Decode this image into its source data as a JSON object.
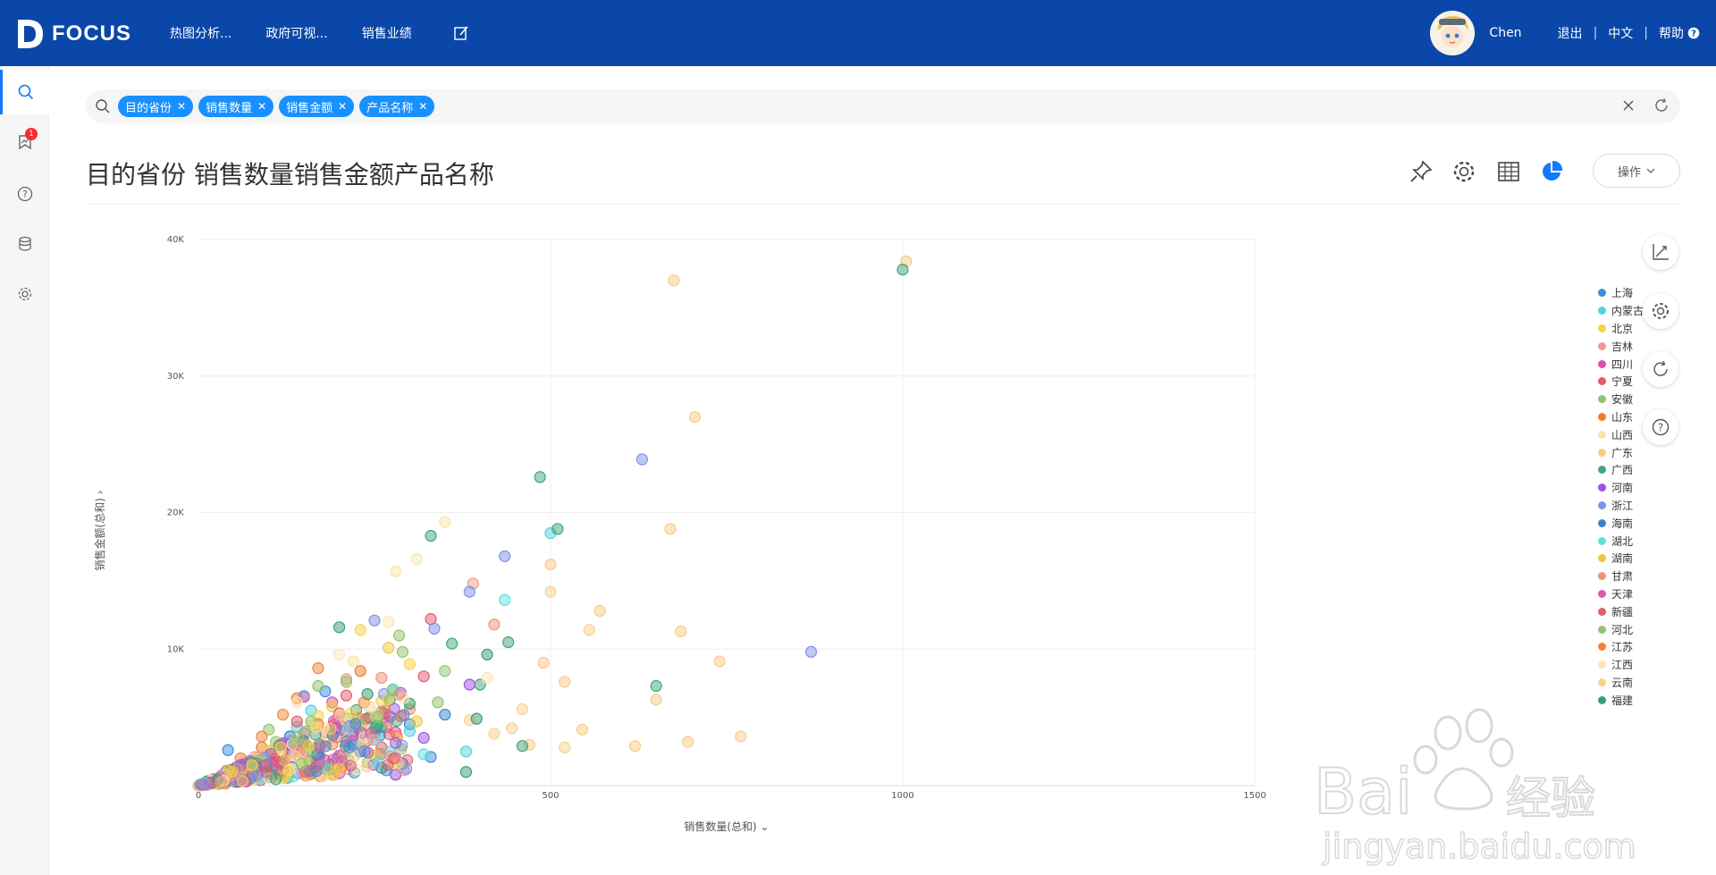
{
  "brand": {
    "name": "FOCUS"
  },
  "nav": {
    "items": [
      "热图分析...",
      "政府可视...",
      "销售业绩"
    ]
  },
  "user": {
    "name": "Chen",
    "logout": "退出",
    "language": "中文",
    "help": "帮助"
  },
  "sidebar": {
    "notification_count": "1"
  },
  "search": {
    "chips": [
      {
        "label": "目的省份"
      },
      {
        "label": "销售数量"
      },
      {
        "label": "销售金额"
      },
      {
        "label": "产品名称"
      }
    ]
  },
  "page": {
    "title": "目的省份 销售数量销售金额产品名称",
    "ops_label": "操作"
  },
  "colors": {
    "topbar": "#0a47a8",
    "accent": "#1890ff"
  },
  "chart_data": {
    "type": "scatter",
    "xlabel": "销售数量(总和)",
    "ylabel": "销售金额(总和)",
    "xlim": [
      0,
      1500
    ],
    "ylim": [
      0,
      40000
    ],
    "x_ticks": [
      "0",
      "500",
      "1000",
      "1500"
    ],
    "y_ticks": [
      "10K",
      "20K",
      "30K",
      "40K"
    ],
    "legend_position": "right",
    "grid": true,
    "series": [
      {
        "name": "上海",
        "color": "#3b8fd9",
        "points": [
          [
            42,
            2600
          ],
          [
            180,
            6900
          ],
          [
            210,
            3200
          ],
          [
            330,
            2100
          ],
          [
            70,
            900
          ],
          [
            300,
            4500
          ],
          [
            120,
            1800
          ],
          [
            260,
            5400
          ]
        ]
      },
      {
        "name": "内蒙古",
        "color": "#57d0e0",
        "points": [
          [
            500,
            18500
          ],
          [
            160,
            5500
          ],
          [
            300,
            4000
          ],
          [
            380,
            2500
          ],
          [
            220,
            3600
          ],
          [
            90,
            1200
          ],
          [
            140,
            4300
          ]
        ]
      },
      {
        "name": "北京",
        "color": "#f5d24a",
        "points": [
          [
            230,
            11400
          ],
          [
            300,
            8900
          ],
          [
            170,
            5100
          ],
          [
            60,
            1300
          ],
          [
            110,
            2700
          ],
          [
            260,
            6200
          ]
        ]
      },
      {
        "name": "吉林",
        "color": "#f29b8c",
        "points": [
          [
            390,
            14800
          ],
          [
            210,
            7800
          ],
          [
            150,
            3300
          ],
          [
            80,
            2100
          ],
          [
            240,
            4900
          ]
        ]
      },
      {
        "name": "四川",
        "color": "#d94fb0",
        "points": [
          [
            190,
            6100
          ],
          [
            120,
            3100
          ],
          [
            60,
            800
          ],
          [
            280,
            3900
          ],
          [
            170,
            2200
          ]
        ]
      },
      {
        "name": "宁夏",
        "color": "#e35b6b",
        "points": [
          [
            330,
            12200
          ],
          [
            210,
            6600
          ],
          [
            140,
            4700
          ],
          [
            90,
            1900
          ],
          [
            260,
            2800
          ]
        ]
      },
      {
        "name": "安徽",
        "color": "#8fc46a",
        "points": [
          [
            290,
            9800
          ],
          [
            170,
            7300
          ],
          [
            100,
            4100
          ],
          [
            60,
            1500
          ],
          [
            230,
            3700
          ],
          [
            340,
            6100
          ]
        ]
      },
      {
        "name": "山东",
        "color": "#f07d2e",
        "points": [
          [
            230,
            8400
          ],
          [
            140,
            6400
          ],
          [
            90,
            2800
          ],
          [
            170,
            4500
          ],
          [
            40,
            1100
          ]
        ]
      },
      {
        "name": "山西",
        "color": "#fbe3a8",
        "points": [
          [
            350,
            19300
          ],
          [
            280,
            15700
          ],
          [
            220,
            9100
          ],
          [
            160,
            4400
          ],
          [
            80,
            2000
          ]
        ]
      },
      {
        "name": "广东",
        "color": "#f7cc86",
        "points": [
          [
            1005,
            38400
          ],
          [
            675,
            37000
          ],
          [
            705,
            27000
          ],
          [
            670,
            18800
          ],
          [
            500,
            16200
          ],
          [
            570,
            12800
          ],
          [
            685,
            11300
          ],
          [
            740,
            9100
          ],
          [
            650,
            6300
          ],
          [
            770,
            3600
          ],
          [
            470,
            3000
          ],
          [
            520,
            7600
          ],
          [
            620,
            2900
          ],
          [
            490,
            9000
          ],
          [
            545,
            4100
          ],
          [
            695,
            3200
          ]
        ]
      },
      {
        "name": "广西",
        "color": "#3fa877",
        "points": [
          [
            1000,
            37800
          ],
          [
            485,
            22600
          ],
          [
            510,
            18800
          ],
          [
            330,
            18300
          ],
          [
            650,
            7300
          ],
          [
            400,
            7400
          ],
          [
            440,
            10500
          ],
          [
            360,
            10400
          ],
          [
            460,
            2900
          ]
        ]
      },
      {
        "name": "河南",
        "color": "#9a54e0",
        "points": [
          [
            385,
            7400
          ],
          [
            280,
            800
          ],
          [
            200,
            2200
          ],
          [
            120,
            1400
          ],
          [
            320,
            3500
          ]
        ]
      },
      {
        "name": "浙江",
        "color": "#7b93e8",
        "points": [
          [
            630,
            23900
          ],
          [
            870,
            9800
          ],
          [
            435,
            16800
          ],
          [
            250,
            12100
          ],
          [
            385,
            14200
          ],
          [
            335,
            11500
          ],
          [
            200,
            4100
          ]
        ]
      },
      {
        "name": "海南",
        "color": "#3386c9",
        "points": [
          [
            350,
            5200
          ],
          [
            230,
            2500
          ],
          [
            130,
            3600
          ],
          [
            70,
            600
          ],
          [
            290,
            1600
          ]
        ]
      },
      {
        "name": "湖北",
        "color": "#5fe0e0",
        "points": [
          [
            435,
            13600
          ],
          [
            150,
            6600
          ],
          [
            250,
            4200
          ],
          [
            320,
            2300
          ],
          [
            110,
            1000
          ]
        ]
      },
      {
        "name": "湖南",
        "color": "#f0c93a",
        "points": [
          [
            270,
            10100
          ],
          [
            190,
            5800
          ],
          [
            100,
            2500
          ],
          [
            310,
            4700
          ],
          [
            150,
            900
          ]
        ]
      },
      {
        "name": "甘肃",
        "color": "#f1927a",
        "points": [
          [
            420,
            11800
          ],
          [
            260,
            7900
          ],
          [
            180,
            3900
          ],
          [
            100,
            2200
          ],
          [
            300,
            5600
          ]
        ]
      },
      {
        "name": "天津",
        "color": "#d65ab5",
        "points": [
          [
            150,
            6500
          ],
          [
            240,
            3300
          ],
          [
            90,
            1600
          ],
          [
            200,
            900
          ],
          [
            280,
            2000
          ]
        ]
      },
      {
        "name": "新疆",
        "color": "#df5c70",
        "points": [
          [
            320,
            8000
          ],
          [
            200,
            5300
          ],
          [
            130,
            2400
          ],
          [
            70,
            1100
          ],
          [
            250,
            3900
          ]
        ]
      },
      {
        "name": "河北",
        "color": "#95c46e",
        "points": [
          [
            285,
            11000
          ],
          [
            210,
            7600
          ],
          [
            160,
            4700
          ],
          [
            110,
            3200
          ],
          [
            350,
            8400
          ]
        ]
      },
      {
        "name": "江苏",
        "color": "#f2853a",
        "points": [
          [
            170,
            8600
          ],
          [
            120,
            5200
          ],
          [
            60,
            2000
          ],
          [
            210,
            3000
          ],
          [
            90,
            3600
          ]
        ]
      },
      {
        "name": "江西",
        "color": "#fbe6b5",
        "points": [
          [
            310,
            16600
          ],
          [
            270,
            12000
          ],
          [
            200,
            9600
          ],
          [
            140,
            6100
          ],
          [
            410,
            7900
          ]
        ]
      },
      {
        "name": "云南",
        "color": "#f9d28f",
        "points": [
          [
            555,
            11400
          ],
          [
            500,
            14200
          ],
          [
            460,
            5600
          ],
          [
            420,
            3800
          ],
          [
            385,
            4800
          ],
          [
            445,
            4200
          ],
          [
            520,
            2800
          ]
        ]
      },
      {
        "name": "福建",
        "color": "#3b9e73",
        "points": [
          [
            200,
            11600
          ],
          [
            240,
            6700
          ],
          [
            300,
            6000
          ],
          [
            395,
            4900
          ],
          [
            410,
            9600
          ],
          [
            260,
            1300
          ],
          [
            380,
            1000
          ]
        ]
      }
    ]
  }
}
